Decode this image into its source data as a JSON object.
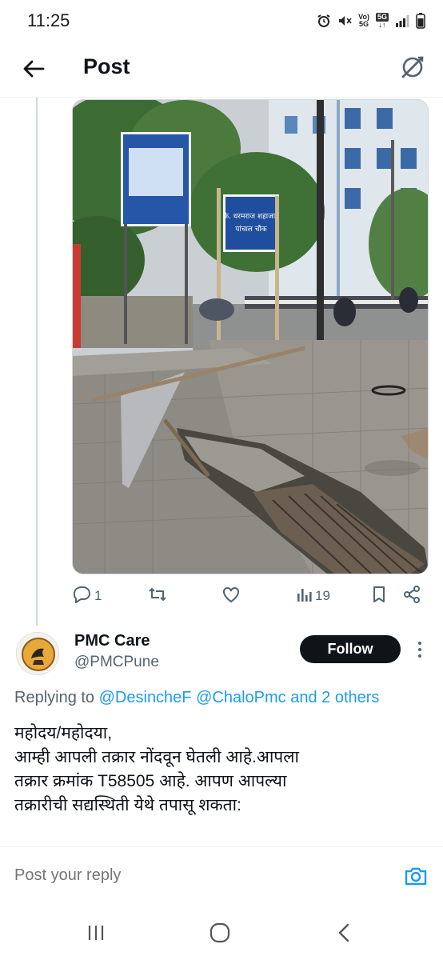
{
  "status_bar": {
    "time": "11:25",
    "volte_top": "Vo)",
    "volte_bottom": "5G",
    "net_badge": "5G"
  },
  "header": {
    "title": "Post"
  },
  "image_signs": {
    "road_sign_line1": "के. धरमराज शहाजाद",
    "road_sign_line2": "पांचाल चौक"
  },
  "actions": {
    "replies": "1",
    "views": "19"
  },
  "reply_post": {
    "author_name": "PMC Care",
    "author_handle": "@PMCPune",
    "follow_label": "Follow",
    "replying_prefix": "Replying to",
    "replying_mention1": "@DesincheF",
    "replying_mention2": "@ChaloPmc",
    "replying_more": "and 2 others",
    "text_line1": "महोदय/महोदया,",
    "text_line2": "आम्ही आपली तक्रार नोंदवून घेतली आहे.आपला",
    "text_line3": "तक्रार क्रमांक T58505 आहे. आपण आपल्या",
    "text_line4": "तक्रारीची सद्यस्थिती येथे तपासू शकता:"
  },
  "composer": {
    "placeholder": "Post your reply"
  },
  "colors": {
    "accent": "#1d9bf0",
    "text_primary": "#0f1419",
    "text_secondary": "#536471"
  },
  "icons": [
    "back-arrow-icon",
    "grok-icon",
    "reply-icon",
    "repost-icon",
    "like-icon",
    "views-icon",
    "bookmark-icon",
    "share-icon",
    "camera-icon",
    "recents-icon",
    "home-icon",
    "back-icon"
  ]
}
